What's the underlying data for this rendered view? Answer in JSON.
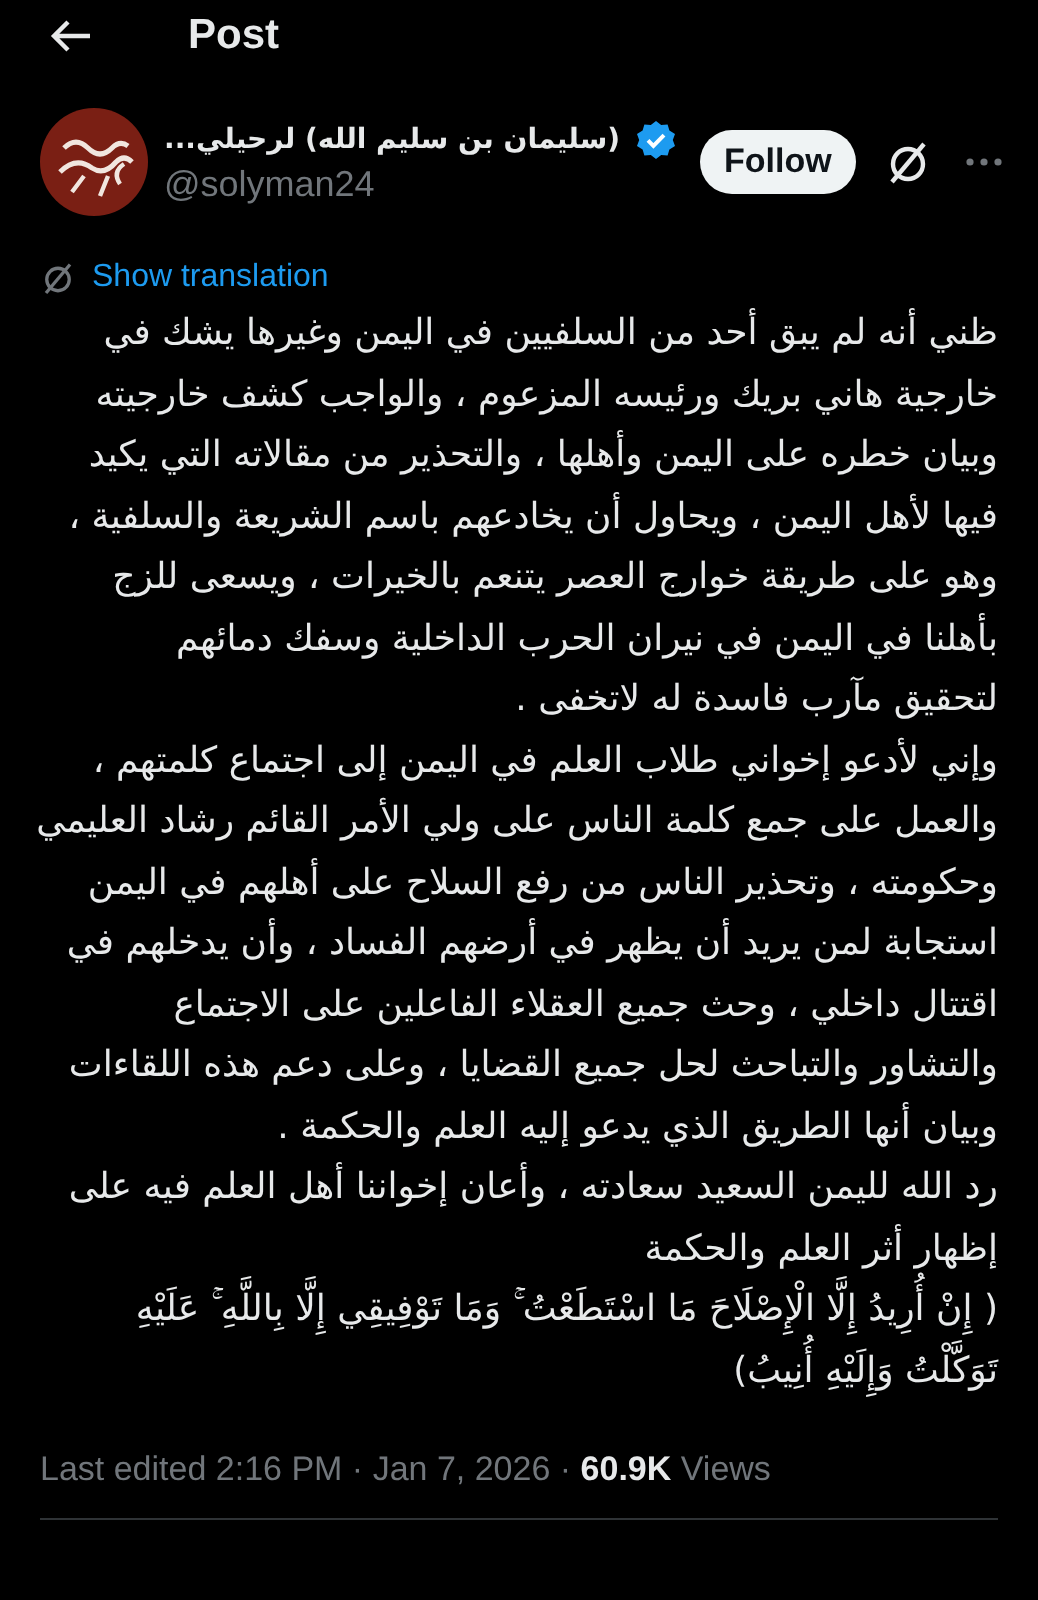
{
  "header": {
    "title": "Post"
  },
  "author": {
    "name": "(سليمان بن سليم الله) لرحيلي...",
    "verified": true,
    "handle": "@solyman24",
    "follow_label": "Follow"
  },
  "translation": {
    "label": "Show translation"
  },
  "body": [
    {
      "lines": [
        "ظني أنه لم  يبق أحد من السلفيين في اليمن وغيرها  يشك في",
        "خارجية هاني بريك ورئيسه المزعوم ، والواجب كشف خارجيته",
        "وبيان خطره على اليمن وأهلها ، والتحذير من مقالاته التي يكيد",
        "فيها لأهل اليمن ، ويحاول أن يخادعهم باسم الشريعة والسلفية ،",
        "وهو على طريقة خوارج العصر يتنعم بالخيرات ، ويسعى للزج",
        "بأهلنا في اليمن في نيران الحرب الداخلية  وسفك دمائهم",
        "لتحقيق مآرب فاسدة له لاتخفى ."
      ]
    },
    {
      "lines": [
        "وإني لأدعو إخواني طلاب العلم في اليمن إلى اجتماع كلمتهم ،",
        "والعمل على جمع كلمة الناس على ولي الأمر القائم رشاد العليمي",
        "وحكومته ، وتحذير الناس من رفع السلاح على أهلهم في اليمن",
        "استجابة لمن يريد أن يظهر في أرضهم الفساد ، وأن يدخلهم في",
        "اقتتال داخلي ، وحث جميع العقلاء الفاعلين على الاجتماع",
        "والتشاور والتباحث لحل جميع القضايا ، وعلى دعم هذه اللقاءات",
        "وبيان أنها الطريق الذي يدعو إليه العلم والحكمة ."
      ]
    },
    {
      "lines": [
        "رد الله لليمن السعيد سعادته ، وأعان إخواننا أهل العلم فيه على",
        "إظهار أثر العلم والحكمة"
      ]
    },
    {
      "lines": [
        "( إِنْ أُرِيدُ إِلَّا الْإِصْلَاحَ مَا اسْتَطَعْتُ ۚ وَمَا تَوْفِيقِي إِلَّا بِاللَّهِ ۚ عَلَيْهِ",
        "تَوَكَّلْتُ وَإِلَيْهِ أُنِيبُ)"
      ]
    }
  ],
  "meta": "Last edited 2:16 PM · Jan 7, 2026 · **60.9K** Views"
}
